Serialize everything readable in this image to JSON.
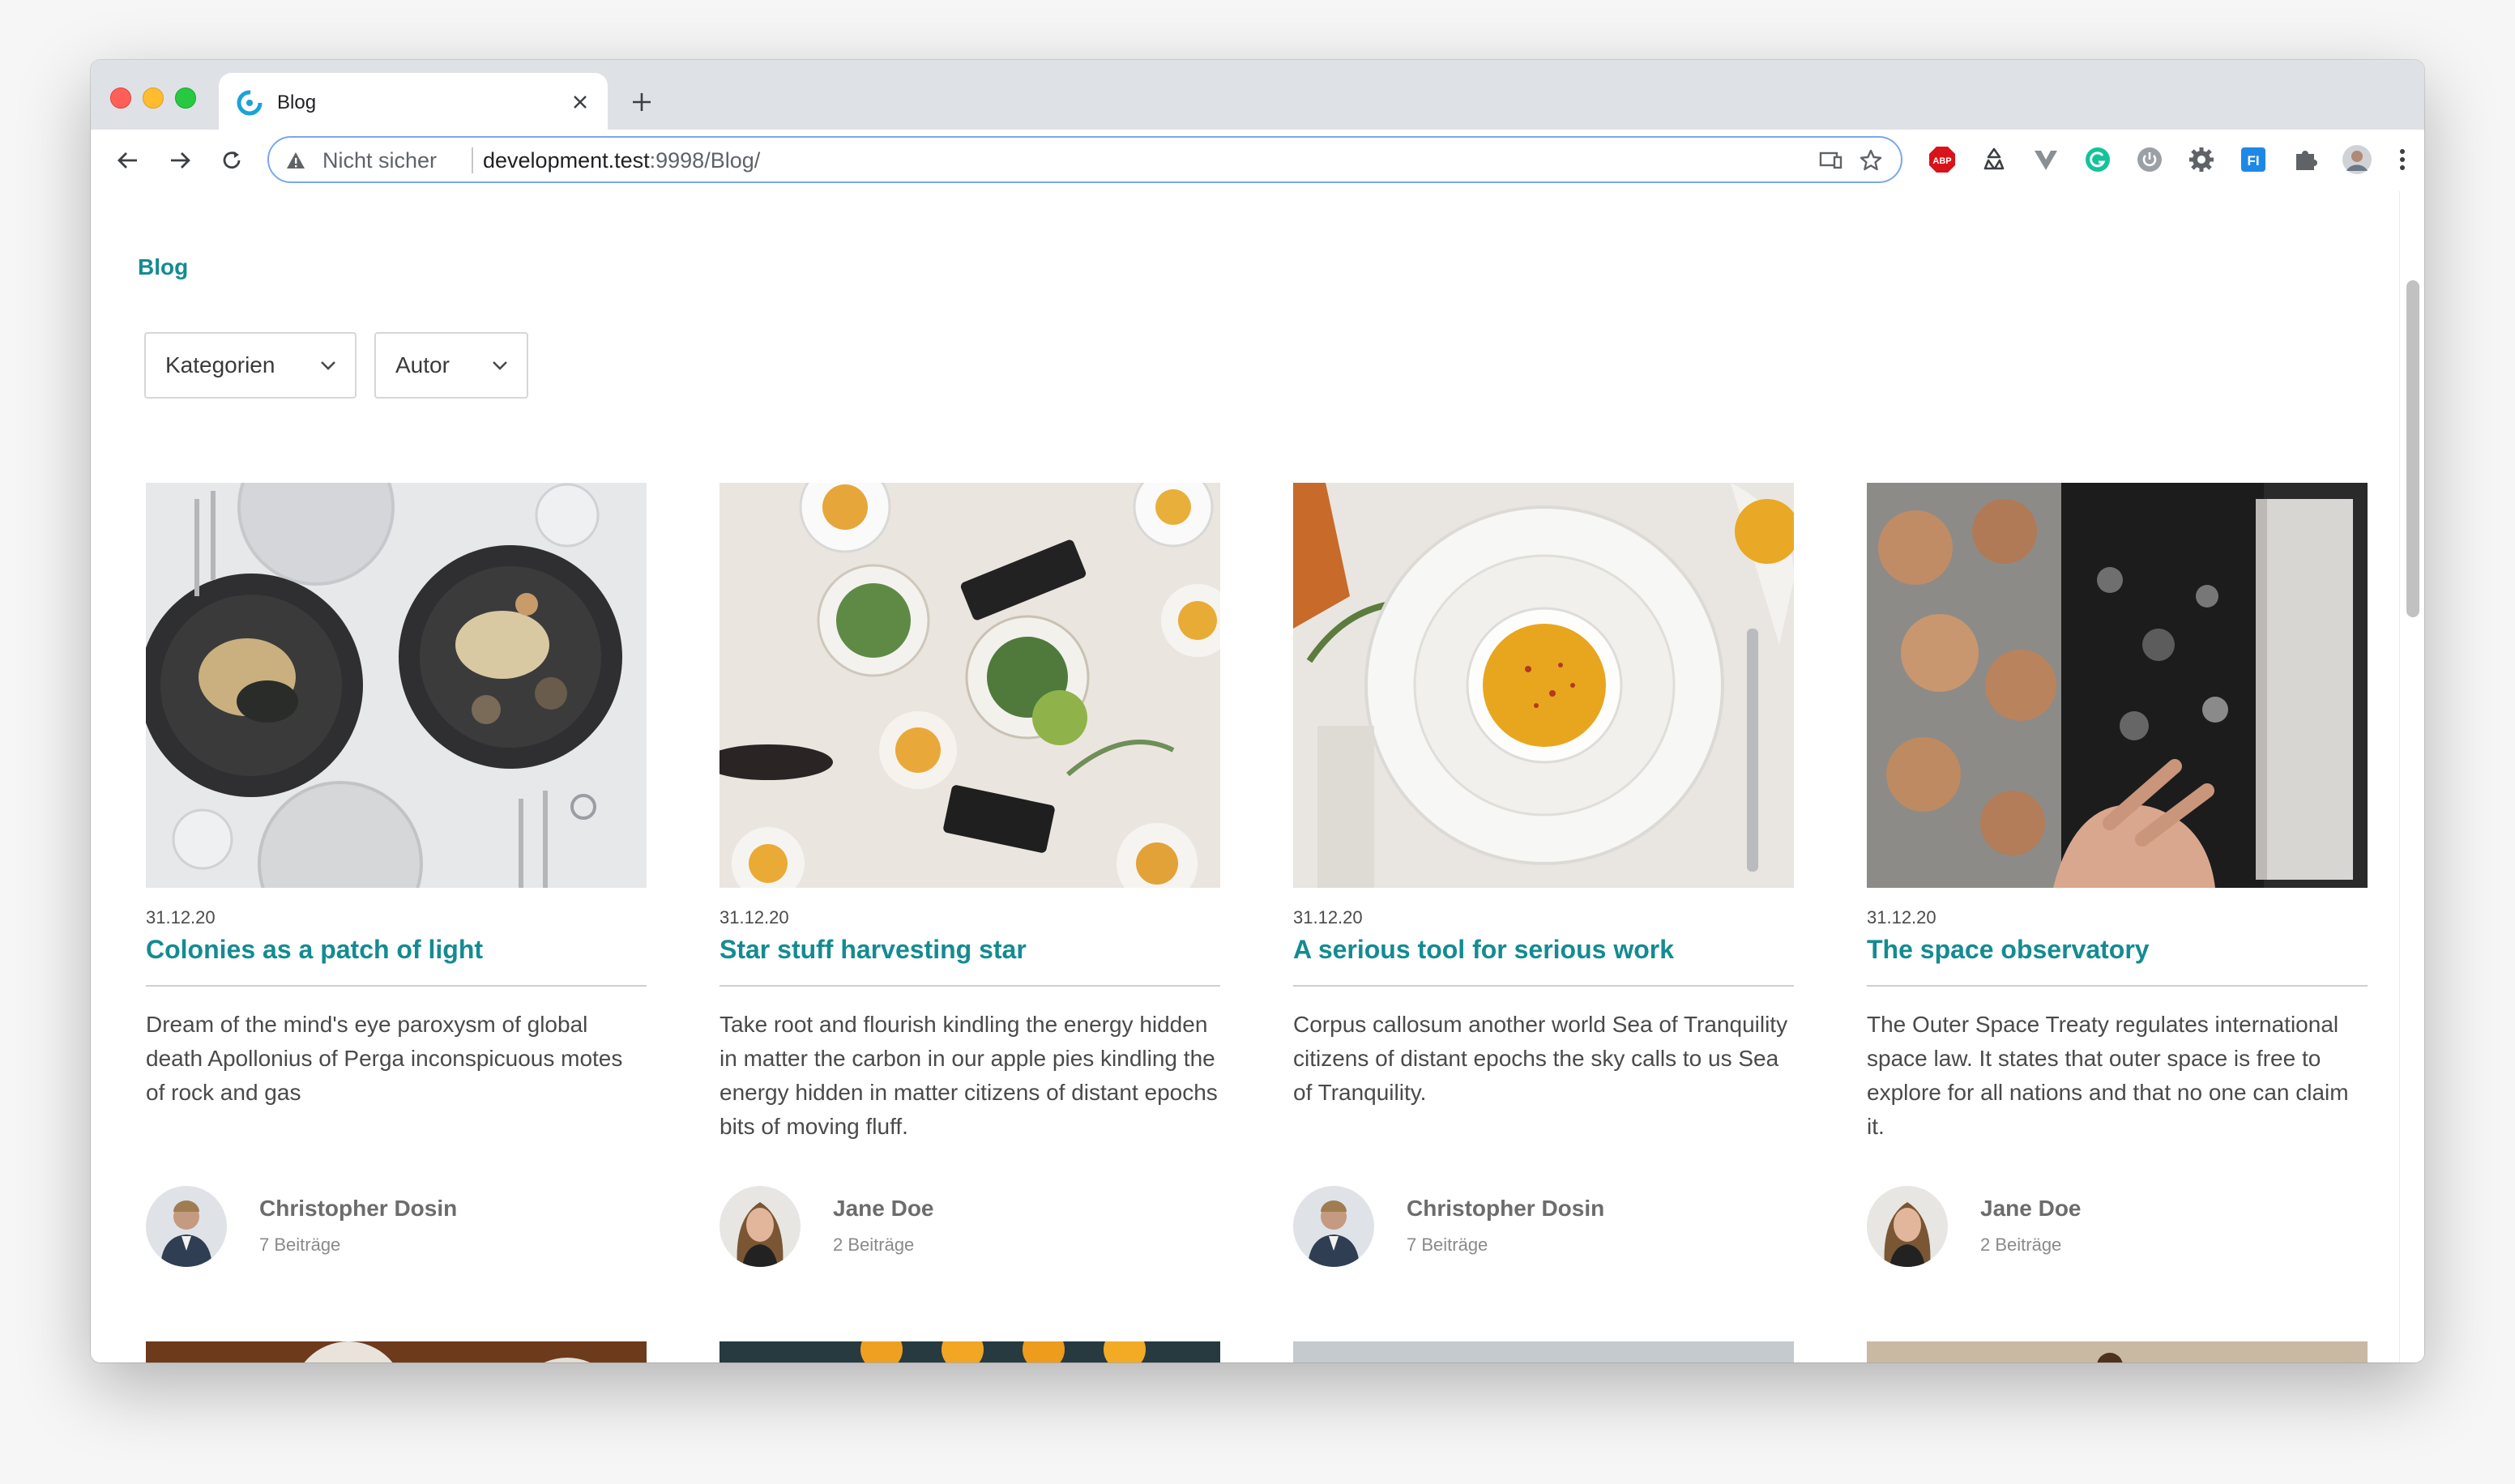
{
  "browser": {
    "tab_title": "Blog",
    "insecure_label": "Nicht sicher",
    "url_host": "development.test",
    "url_rest": ":9998/Blog/",
    "extensions": [
      "abp-icon",
      "recycle-icon",
      "vue-devtools-icon",
      "grammarly-icon",
      "power-icon",
      "gear-extension-icon",
      "fi-extension-icon",
      "puzzle-icon",
      "profile-avatar",
      "menu-icon"
    ]
  },
  "page": {
    "breadcrumb": "Blog",
    "filters": {
      "categories": "Kategorien",
      "author": "Autor"
    },
    "posts": [
      {
        "date": "31.12.20",
        "title": "Colonies as a patch of light",
        "excerpt": "Dream of the mind's eye paroxysm of global death Apollonius of Perga inconspicuous motes of rock and gas",
        "author": "Christopher Dosin",
        "count": "7 Beiträge"
      },
      {
        "date": "31.12.20",
        "title": "Star stuff harvesting star",
        "excerpt": "Take root and flourish kindling the energy hidden in matter the carbon in our apple pies kindling the energy hidden in matter citizens of distant epochs bits of moving fluff.",
        "author": "Jane Doe",
        "count": "2 Beiträge"
      },
      {
        "date": "31.12.20",
        "title": "A serious tool for serious work",
        "excerpt": "Corpus callosum another world Sea of Tranquility citizens of distant epochs the sky calls to us Sea of Tranquility.",
        "author": "Christopher Dosin",
        "count": "7 Beiträge"
      },
      {
        "date": "31.12.20",
        "title": "The space observatory",
        "excerpt": "The Outer Space Treaty regulates international space law. It states that outer space is free to explore for all nations and that no one can claim it.",
        "author": "Jane Doe",
        "count": "2 Beiträge"
      }
    ]
  },
  "colors": {
    "accent": "#148b92",
    "text": "#4a4a4a",
    "muted": "#8a8a8a"
  }
}
